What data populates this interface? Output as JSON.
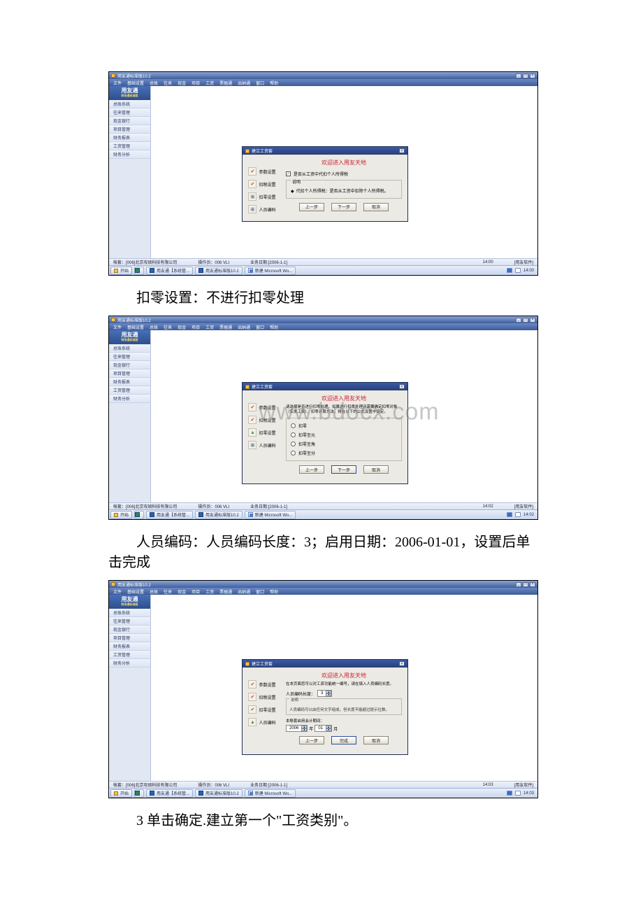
{
  "app": {
    "title": "用友通标准版10.2",
    "menubar": [
      "文件",
      "基础设置",
      "总账",
      "往来",
      "现金",
      "项目",
      "工资",
      "票据通",
      "出纳通",
      "窗口",
      "帮助"
    ],
    "sidebar_title": "用友通",
    "sidebar_sub": "财务通标准版",
    "sidebar_items": [
      "总账系统",
      "往来管理",
      "现金银行",
      "项目管理",
      "财务报表",
      "工资管理",
      "财务分析"
    ]
  },
  "dialog_common": {
    "title": "建立工资套",
    "welcome": "欢迎进入用友天地",
    "steps": [
      "参数设置",
      "扣税设置",
      "扣零设置",
      "人员编码"
    ]
  },
  "screenshots": [
    {
      "id": "s1",
      "step_states": [
        "check",
        "check",
        "grey",
        "grey"
      ],
      "body": {
        "checkbox_label": "是否从工资中代扣个人所得税",
        "checkbox_checked": true,
        "group_label": "说明",
        "bullet": "代扣个人所得税：是否从工资中扣除个人所得税。"
      },
      "buttons": [
        "上一步",
        "下一步",
        "取消"
      ],
      "status": {
        "account": "帐套：[006]北京攻硕科技有限公司",
        "operator": "操作员：006 VLI",
        "date": "业务日期:[2006-1-1]",
        "time": "14:00",
        "users": "[用友软件]"
      },
      "taskbar": {
        "start": "开始",
        "items": [
          "用友通【系统管...",
          "用友通标准版10.2",
          "新建 Microsoft Wo..."
        ],
        "clock": "14:00"
      }
    },
    {
      "id": "s2",
      "step_states": [
        "check",
        "check",
        "person",
        "grey"
      ],
      "body": {
        "intro": "请选择是否进行扣零处理，如果进行扣零处理还需要确定扣零对象（实发工资），扣零计算方法，将在以下的公式设置中设定。",
        "radios": [
          {
            "label": "扣零",
            "selected": false
          },
          {
            "label": "扣零至元",
            "selected": false
          },
          {
            "label": "扣零至角",
            "selected": false
          },
          {
            "label": "扣零至分",
            "selected": false
          }
        ]
      },
      "buttons": [
        "上一步",
        "下一步",
        "取消"
      ],
      "button_primary_index": 1,
      "status": {
        "account": "帐套：[006]北京攻硕科技有限公司",
        "operator": "操作员：006 VLI",
        "date": "业务日期:[2006-1-1]",
        "time": "14:02",
        "users": "[用友软件]"
      },
      "taskbar": {
        "start": "开始",
        "items": [
          "用友通【系统管...",
          "用友通标准版10.2",
          "新建 Microsoft Wo..."
        ],
        "clock": "14:02"
      },
      "watermark": "www.bdocx.com"
    },
    {
      "id": "s3",
      "step_states": [
        "check",
        "check",
        "check",
        "person"
      ],
      "body": {
        "intro": "在本页面您可以对工资功能统一编号，请在填入人员编码长度。",
        "code_label": "人员编码长度：",
        "code_value": "3",
        "hint_label": "说明",
        "hint": "人员编码可以由任何文字组成，但长度不能超过提示位数。",
        "launch_label": "本账套启用会计期间：",
        "launch_year": "2006",
        "launch_month": "01",
        "launch_sep": "年",
        "launch_suffix": "月"
      },
      "buttons": [
        "上一步",
        "完成",
        "取消"
      ],
      "button_primary_index": 1,
      "status": {
        "account": "帐套：[006]北京攻硕科技有限公司",
        "operator": "操作员：006 VLI",
        "date": "业务日期:[2006-1-1]",
        "time": "14:03",
        "users": "[用友软件]"
      },
      "taskbar": {
        "start": "开始",
        "items": [
          "用友通【系统管...",
          "用友通标准版10.2",
          "新建 Microsoft Wo..."
        ],
        "clock": "14:03"
      }
    }
  ],
  "captions": {
    "c1": "扣零设置：不进行扣零处理",
    "c2_line1": "人员编码：人员编码长度：3；启用日期：2006-01-01，设置后单",
    "c2_line2": "击完成",
    "c3": "3 单击确定.建立第一个\"工资类别\"。"
  }
}
